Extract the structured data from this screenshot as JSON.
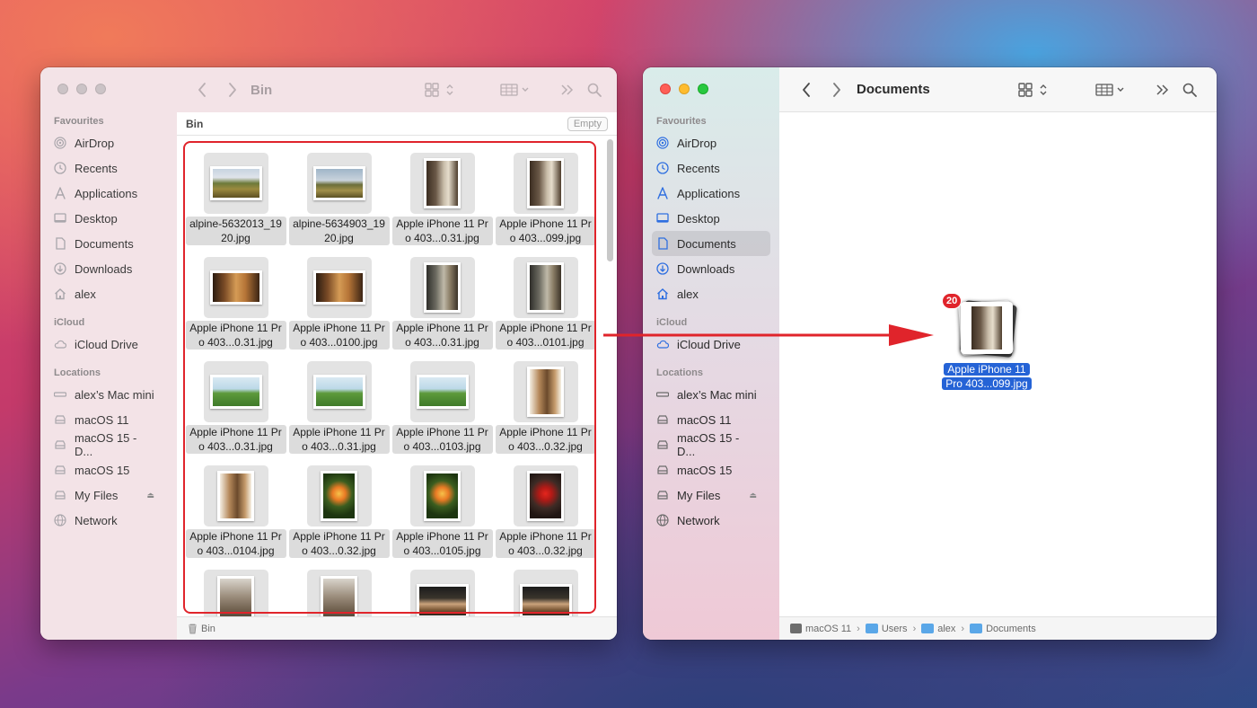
{
  "bin_window": {
    "title": "Bin",
    "path_label": "Bin",
    "empty_button": "Empty",
    "footer_path": "Bin",
    "sidebar": {
      "favourites_header": "Favourites",
      "favourites": [
        {
          "label": "AirDrop",
          "icon": "airdrop-icon"
        },
        {
          "label": "Recents",
          "icon": "clock-icon"
        },
        {
          "label": "Applications",
          "icon": "applications-icon"
        },
        {
          "label": "Desktop",
          "icon": "desktop-icon"
        },
        {
          "label": "Documents",
          "icon": "document-icon"
        },
        {
          "label": "Downloads",
          "icon": "download-icon"
        },
        {
          "label": "alex",
          "icon": "home-icon"
        }
      ],
      "icloud_header": "iCloud",
      "icloud": [
        {
          "label": "iCloud Drive",
          "icon": "cloud-icon"
        }
      ],
      "locations_header": "Locations",
      "locations": [
        {
          "label": "alex’s Mac mini",
          "icon": "mac-mini-icon"
        },
        {
          "label": "macOS 11",
          "icon": "disk-icon"
        },
        {
          "label": "macOS 15 - D...",
          "icon": "disk-icon"
        },
        {
          "label": "macOS 15",
          "icon": "disk-icon"
        },
        {
          "label": "My Files",
          "icon": "disk-icon",
          "eject": true
        },
        {
          "label": "Network",
          "icon": "network-icon"
        }
      ]
    },
    "files": [
      {
        "name": "alpine-5632013_1920.jpg",
        "thumb": "img-alpine1",
        "orient": "land"
      },
      {
        "name": "alpine-5634903_1920.jpg",
        "thumb": "img-alpine2",
        "orient": "land"
      },
      {
        "name": "Apple iPhone 11 Pro 403...0.31.jpg",
        "thumb": "img-cat-door",
        "orient": "port"
      },
      {
        "name": "Apple iPhone 11 Pro 403...099.jpg",
        "thumb": "img-cat-door",
        "orient": "port"
      },
      {
        "name": "Apple iPhone 11 Pro 403...0.31.jpg",
        "thumb": "img-dog-room",
        "orient": "land"
      },
      {
        "name": "Apple iPhone 11 Pro 403...0100.jpg",
        "thumb": "img-dog-room",
        "orient": "land"
      },
      {
        "name": "Apple iPhone 11 Pro 403...0.31.jpg",
        "thumb": "img-cat-hall",
        "orient": "port"
      },
      {
        "name": "Apple iPhone 11 Pro 403...0101.jpg",
        "thumb": "img-cat-hall",
        "orient": "port"
      },
      {
        "name": "Apple iPhone 11 Pro 403...0.31.jpg",
        "thumb": "img-lawn",
        "orient": "land"
      },
      {
        "name": "Apple iPhone 11 Pro 403...0.31.jpg",
        "thumb": "img-lawn",
        "orient": "land"
      },
      {
        "name": "Apple iPhone 11 Pro 403...0103.jpg",
        "thumb": "img-lawn",
        "orient": "land"
      },
      {
        "name": "Apple iPhone 11 Pro 403...0.32.jpg",
        "thumb": "img-wood",
        "orient": "port"
      },
      {
        "name": "Apple iPhone 11 Pro 403...0104.jpg",
        "thumb": "img-wood",
        "orient": "port"
      },
      {
        "name": "Apple iPhone 11 Pro 403...0.32.jpg",
        "thumb": "img-flower",
        "orient": "port"
      },
      {
        "name": "Apple iPhone 11 Pro 403...0105.jpg",
        "thumb": "img-flower",
        "orient": "port"
      },
      {
        "name": "Apple iPhone 11 Pro 403...0.32.jpg",
        "thumb": "img-red-flower",
        "orient": "port"
      },
      {
        "name": "",
        "thumb": "img-squirrel",
        "orient": "port"
      },
      {
        "name": "",
        "thumb": "img-squirrel",
        "orient": "port"
      },
      {
        "name": "",
        "thumb": "img-cat-stair",
        "orient": "land"
      },
      {
        "name": "",
        "thumb": "img-cat-stair",
        "orient": "land"
      }
    ]
  },
  "docs_window": {
    "title": "Documents",
    "sidebar": {
      "favourites_header": "Favourites",
      "favourites": [
        {
          "label": "AirDrop",
          "icon": "airdrop-icon"
        },
        {
          "label": "Recents",
          "icon": "clock-icon"
        },
        {
          "label": "Applications",
          "icon": "applications-icon"
        },
        {
          "label": "Desktop",
          "icon": "desktop-icon"
        },
        {
          "label": "Documents",
          "icon": "document-icon",
          "selected": true
        },
        {
          "label": "Downloads",
          "icon": "download-icon"
        },
        {
          "label": "alex",
          "icon": "home-icon"
        }
      ],
      "icloud_header": "iCloud",
      "icloud": [
        {
          "label": "iCloud Drive",
          "icon": "cloud-icon"
        }
      ],
      "locations_header": "Locations",
      "locations": [
        {
          "label": "alex’s Mac mini",
          "icon": "mac-mini-icon"
        },
        {
          "label": "macOS 11",
          "icon": "disk-icon"
        },
        {
          "label": "macOS 15 - D...",
          "icon": "disk-icon"
        },
        {
          "label": "macOS 15",
          "icon": "disk-icon"
        },
        {
          "label": "My Files",
          "icon": "disk-icon",
          "eject": true
        },
        {
          "label": "Network",
          "icon": "network-icon"
        }
      ]
    },
    "breadcrumbs": [
      {
        "label": "macOS 11",
        "icon": "disk-icon"
      },
      {
        "label": "Users",
        "icon": "folder-icon"
      },
      {
        "label": "alex",
        "icon": "folder-icon"
      },
      {
        "label": "Documents",
        "icon": "folder-icon"
      }
    ]
  },
  "drag": {
    "count": "20",
    "label": "Apple iPhone 11 Pro 403...099.jpg"
  },
  "colors": {
    "selection_outline": "#e0242b",
    "arrow": "#e0242b",
    "selected_label": "#2563d6",
    "badge": "#e0242b"
  }
}
